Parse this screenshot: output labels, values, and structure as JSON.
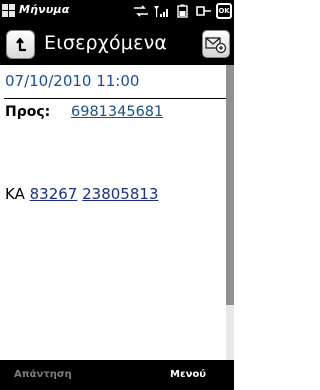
{
  "status_bar": {
    "app_title": "Μήνυμα",
    "icons": [
      "windows-flag-icon",
      "data-transfer-icon",
      "signal-strength-icon",
      "battery-icon",
      "connection-icon"
    ],
    "ok_label": "OK"
  },
  "header": {
    "title": "Εισερχόμενα",
    "back_icon": "back-arrow-icon",
    "folder_icon": "move-to-folder-icon"
  },
  "message": {
    "timestamp": "07/10/2010 11:00",
    "to_label": "Προς:",
    "to_number": "6981345681",
    "body_prefix": "KA ",
    "body_link_1": "83267",
    "body_link_2": "23805813"
  },
  "softkeys": {
    "left": "Απάντηση",
    "right": "Μενού"
  },
  "colors": {
    "date_text": "#1a4fa0",
    "link_text": "#1a2f8a",
    "bars": "#000000"
  }
}
